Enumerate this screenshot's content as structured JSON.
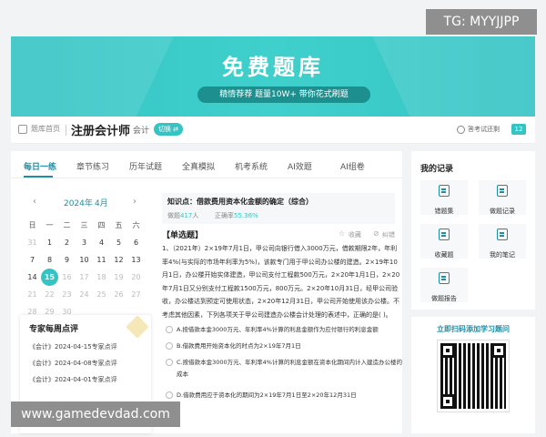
{
  "watermarks": {
    "top": "TG: MYYJJPP",
    "bottom": "www.gamedevdad.com"
  },
  "banner": {
    "title": "免费题库",
    "subtitle": "精情荐荐 题量10W+ 带你花式刷题"
  },
  "header": {
    "home": "题库首页",
    "exam_title": "注册会计师",
    "subject": "会计",
    "switch_label": "切换 ⇄",
    "right_text": "答考试还剩",
    "right_count": "12"
  },
  "tabs": [
    "每日一练",
    "章节练习",
    "历年试题",
    "全真模拟",
    "机考系统",
    "AI效题",
    "AI组卷"
  ],
  "calendar": {
    "prev": "‹",
    "next": "›",
    "year": "2024年",
    "month": "4月",
    "weekdays": [
      "日",
      "一",
      "二",
      "三",
      "四",
      "五",
      "六"
    ],
    "weeks": [
      [
        "31",
        "1",
        "2",
        "3",
        "4",
        "5",
        "6"
      ],
      [
        "7",
        "8",
        "9",
        "10",
        "11",
        "12",
        "13"
      ],
      [
        "14",
        "15",
        "16",
        "17",
        "18",
        "19",
        "20"
      ],
      [
        "21",
        "22",
        "23",
        "24",
        "25",
        "26",
        "27"
      ],
      [
        "28",
        "29",
        "30",
        "",
        "",
        "",
        ""
      ]
    ],
    "today": "15"
  },
  "expert": {
    "title": "专家每周点评",
    "items": [
      "《会计》2024-04-15专家点评",
      "《会计》2024-04-08专家点评",
      "《会计》2024-04-01专家点评"
    ]
  },
  "knowledge_point": {
    "title": "知识点：借款费用资本化金额的确定（综合）",
    "done_label": "做题",
    "done_count": "417",
    "done_unit": "人",
    "rate_label": "正确率",
    "rate_value": "55.36%"
  },
  "question": {
    "type": "【单选题】",
    "favorite": "收藏",
    "correct": "纠错",
    "stem": "1、（2021年）2×19年7月1日，甲公司向银行借入3000万元，借款期限2年，年利率4%(与实际的市场年利率为5%)，该款专门用于甲公司办公楼的建造。2×19年10月1日，办公楼开始实体建造，甲公司支付工程款500万元，2×20年1月1日，2×20年7月1日又分别支付工程款1500万元，800万元。2×20年10月31日，经甲公司验收，办公楼达到预定可使用状态，2×20年12月31日，甲公司开始使用该办公楼。不考虑其他因素，下列各项关于甲公司建造办公楼会计处理的表述中，正确的是(   )。",
    "options": [
      "A.按借款本金3000万元、年利率4%计算的利息金额作为应付银行的利息金额",
      "B.借款费用开始资本化的时点为2×19年7月1日",
      "C.按借款本金3000万元、年利率4%计算的利息金额在资本化期间内计入建造办公楼的成本",
      "D.借款费用应于资本化的期间为2×19年7月1日至2×20年12月31日"
    ]
  },
  "records": {
    "title": "我的记录",
    "items": [
      "错题集",
      "做题记录",
      "收藏题",
      "我的笔记",
      "做题报告"
    ]
  },
  "qr": {
    "title": "立即扫码添加学习题问"
  }
}
